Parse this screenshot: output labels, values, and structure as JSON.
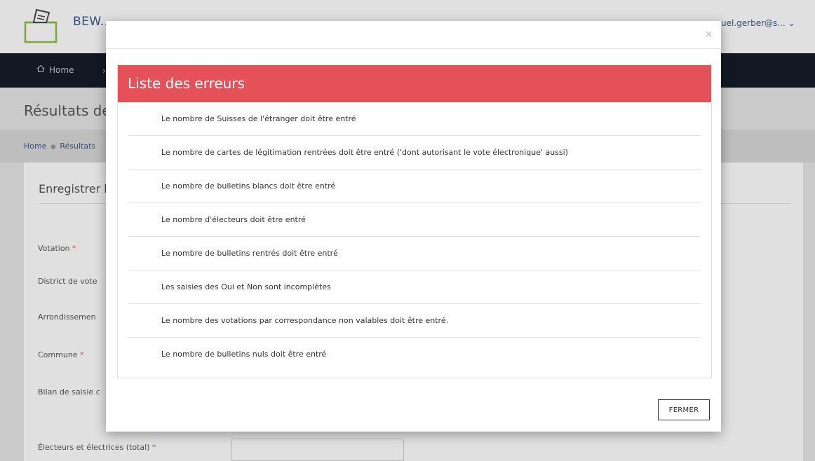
{
  "header": {
    "brand": "BEW...",
    "user": "uel.gerber@s... ⌄"
  },
  "nav": {
    "home": "Home",
    "second_dot": "›"
  },
  "page": {
    "title": "Résultats de",
    "breadcrumb_home": "Home",
    "breadcrumb_current": "Résultats"
  },
  "form": {
    "card_title": "Enregistrer l",
    "fields": [
      {
        "label": "Votation",
        "required": "*"
      },
      {
        "label": "District de vote",
        "required": ""
      },
      {
        "label": "Arrondissemen",
        "required": ""
      },
      {
        "label": "Commune",
        "required": "*"
      },
      {
        "label": "Bilan de saisie c",
        "required": ""
      },
      {
        "label": "Électeurs et électrices (total)",
        "required": "*"
      }
    ]
  },
  "modal": {
    "close_symbol": "×",
    "panel_title": "Liste des erreurs",
    "errors": [
      "Le nombre de Suisses de l'étranger doit être entré",
      "Le nombre de cartes de légitimation rentrées doit être entré ('dont autorisant le vote électronique' aussi)",
      "Le nombre de bulletins blancs doit être entré",
      "Le nombre d'électeurs doit être entré",
      "Le nombre de bulletins rentrés doit être entré",
      "Les saisies des Oui et Non sont incomplètes",
      "Le nombre des votations par correspondance non valables doit être entré.",
      "Le nombre de bulletins nuls doit être entré"
    ],
    "close_button": "FERMER"
  },
  "colors": {
    "panel_header": "#e55159",
    "navbar": "#161d2a",
    "brand": "#3b5b86",
    "logo_green": "#8fbf3e",
    "required": "#e95d66"
  },
  "icons": {
    "logo": "ballot-box-icon",
    "home": "home-icon",
    "user_menu": "chevron-down-icon",
    "close": "close-icon"
  }
}
